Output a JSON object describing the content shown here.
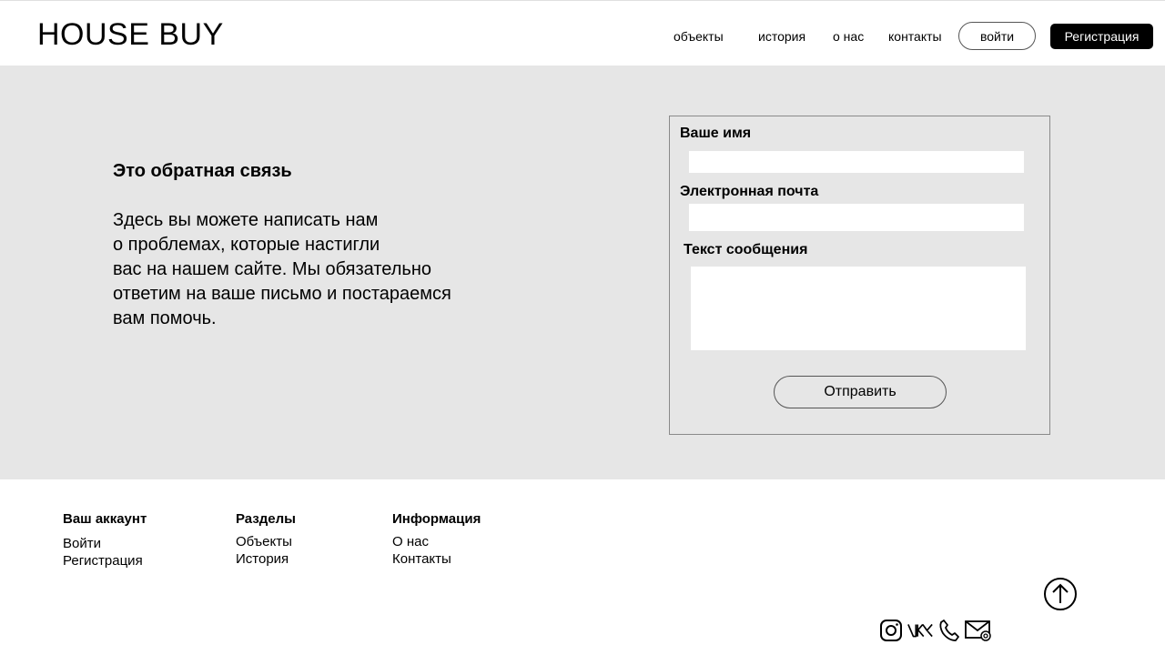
{
  "header": {
    "logo": "HOUSE BUY",
    "nav": {
      "objects": "объекты",
      "history": "история",
      "about": "о нас",
      "contacts": "контакты"
    },
    "login_label": "войти",
    "register_label": "Регистрация"
  },
  "feedback": {
    "title": "Это обратная связь",
    "text": "Здесь вы можете написать нам\nо проблемах, которые настигли\nвас на нашем сайте. Мы обязательно\nответим на ваше письмо и постараемся\nвам помочь."
  },
  "form": {
    "name_label": "Ваше имя",
    "name_value": "",
    "email_label": "Электронная почта",
    "email_value": "",
    "message_label": "Текст сообщения",
    "message_value": "",
    "send_label": "Отправить"
  },
  "footer": {
    "account": {
      "heading": "Ваш аккаунт",
      "links": [
        "Войти",
        "Регистрация"
      ]
    },
    "sections": {
      "heading": "Разделы",
      "links": [
        "Объекты",
        "История"
      ]
    },
    "info": {
      "heading": "Информация",
      "links": [
        "О нас",
        "Контакты"
      ]
    },
    "icons": [
      "arrow-up-icon",
      "instagram-icon",
      "vk-icon",
      "phone-icon",
      "mail-icon"
    ]
  },
  "colors": {
    "band": "#e6e6e6",
    "text": "#000000",
    "register_bg": "#000000",
    "register_text": "#ffffff"
  }
}
